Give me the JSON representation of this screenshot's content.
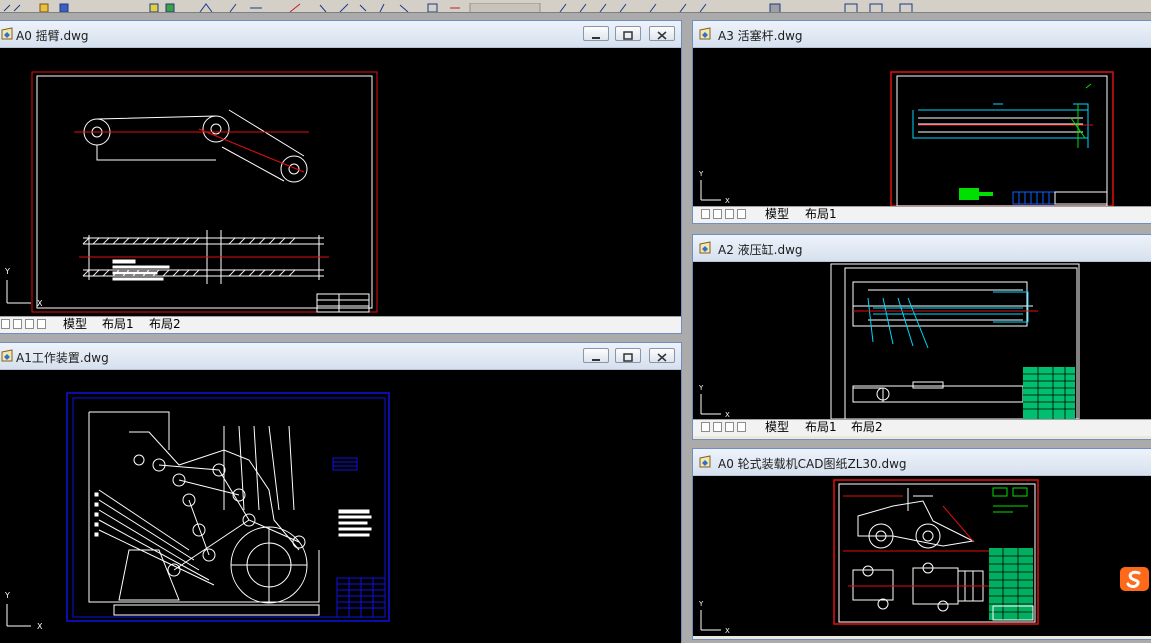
{
  "windows": [
    {
      "id": "w1",
      "title": "A0 摇臂.dwg",
      "tabs": [
        "模型",
        "布局1",
        "布局2"
      ],
      "buttons": true
    },
    {
      "id": "w2",
      "title": "A1工作装置.dwg",
      "tabs": [],
      "buttons": true
    },
    {
      "id": "w3",
      "title": "A3 活塞杆.dwg",
      "tabs": [
        "模型",
        "布局1"
      ],
      "buttons": false
    },
    {
      "id": "w4",
      "title": "A2 液压缸.dwg",
      "tabs": [
        "模型",
        "布局1",
        "布局2"
      ],
      "buttons": false
    },
    {
      "id": "w5",
      "title": "A0 轮式装载机CAD图纸ZL30.dwg",
      "tabs": [],
      "buttons": false
    }
  ],
  "ucs": {
    "x_label": "X",
    "y_label": "Y"
  },
  "colors": {
    "frame_red": "#e01010",
    "frame_blue": "#1010e0",
    "line_white": "#ffffff",
    "cyan": "#00d8ff",
    "green": "#00e000"
  },
  "icons": [
    "drawing-file-icon",
    "minimize-icon",
    "restore-icon",
    "close-icon",
    "sogou-ime-icon"
  ]
}
